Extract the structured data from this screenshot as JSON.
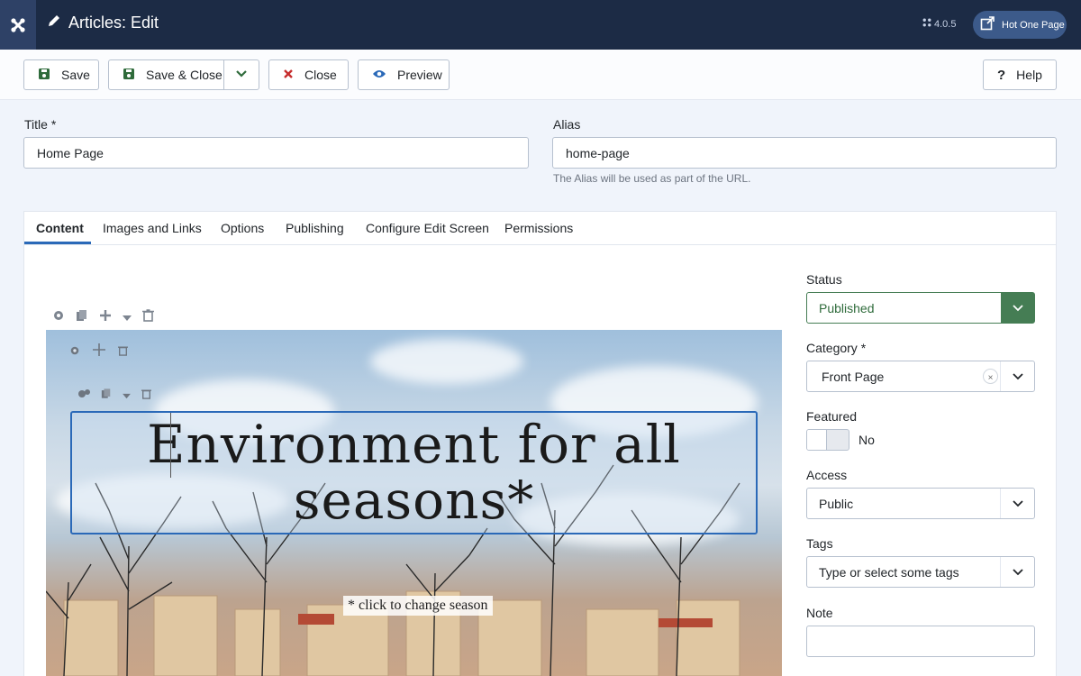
{
  "header": {
    "title": "Articles: Edit",
    "version": "4.0.5",
    "site_button": "Hot One Page"
  },
  "toolbar": {
    "save": "Save",
    "save_close": "Save & Close",
    "close": "Close",
    "preview": "Preview",
    "help": "Help"
  },
  "form": {
    "title_label": "Title *",
    "title_value": "Home Page",
    "alias_label": "Alias",
    "alias_value": "home-page",
    "alias_hint": "The Alias will be used as part of the URL."
  },
  "tabs": [
    "Content",
    "Images and Links",
    "Options",
    "Publishing",
    "Configure Edit Screen",
    "Permissions"
  ],
  "editor": {
    "headline_line1": "Environment for all",
    "headline_line2": "seasons*",
    "season_link": "* click to change season"
  },
  "sidebar": {
    "status_label": "Status",
    "status_value": "Published",
    "category_label": "Category *",
    "category_value": "Front Page",
    "featured_label": "Featured",
    "featured_value": "No",
    "access_label": "Access",
    "access_value": "Public",
    "tags_label": "Tags",
    "tags_placeholder": "Type or select some tags",
    "note_label": "Note",
    "note_value": ""
  },
  "colors": {
    "header_bg": "#1c2b45",
    "accent": "#2a69b8",
    "status_green": "#457d54",
    "close_red": "#c62d2d"
  }
}
